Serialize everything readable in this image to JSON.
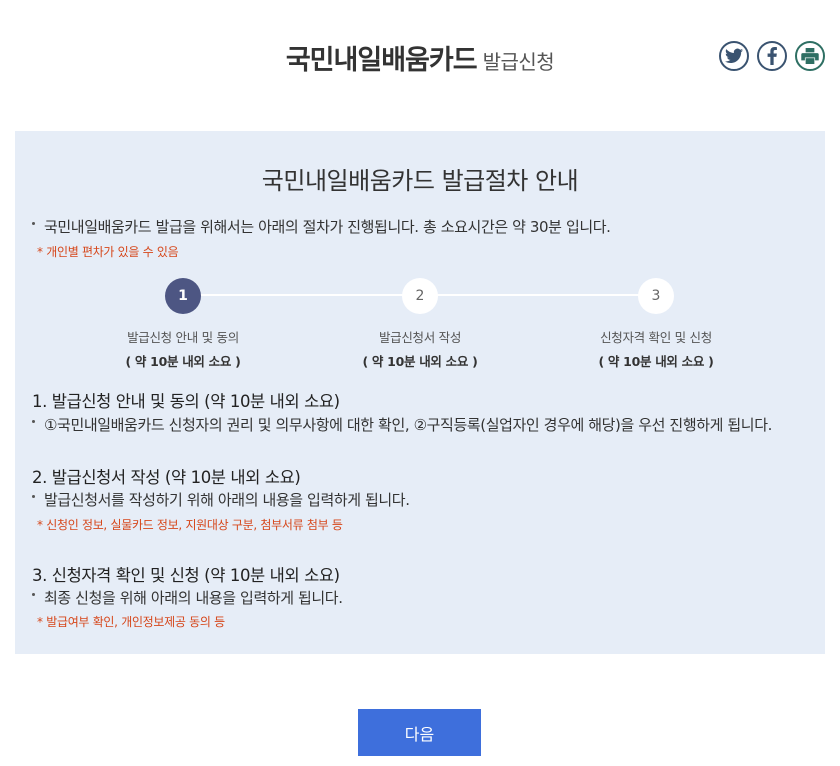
{
  "header": {
    "title_main": "국민내일배움카드",
    "title_sub": "발급신청",
    "share_icons": [
      "twitter-icon",
      "facebook-icon",
      "print-icon"
    ],
    "accent_color": "#3e6fdc"
  },
  "panel": {
    "title": "국민내일배움카드 발급절차 안내",
    "intro": "국민내일배움카드 발급을 위해서는 아래의 절차가 진행됩니다. 총 소요시간은 약 30분 입니다.",
    "intro_note": "* 개인별 편차가 있을 수 있음",
    "steps": [
      {
        "number": "1",
        "label": "발급신청 안내 및 동의",
        "time": "( 약 10분 내외 소요 )",
        "active": true
      },
      {
        "number": "2",
        "label": "발급신청서 작성",
        "time": "( 약 10분 내외 소요 )",
        "active": false
      },
      {
        "number": "3",
        "label": "신청자격 확인 및 신청",
        "time": "( 약 10분 내외 소요 )",
        "active": false
      }
    ],
    "sections": [
      {
        "title": "1. 발급신청 안내 및 동의 (약 10분 내외 소요)",
        "desc": "①국민내일배움카드 신청자의 권리 및 의무사항에 대한 확인, ②구직등록(실업자인 경우에 해당)을 우선 진행하게 됩니다.",
        "note": ""
      },
      {
        "title": "2. 발급신청서 작성 (약 10분 내외 소요)",
        "desc": "발급신청서를 작성하기 위해 아래의 내용을 입력하게 됩니다.",
        "note": "* 신청인 정보, 실물카드 정보, 지원대상 구분, 첨부서류 첨부 등"
      },
      {
        "title": "3. 신청자격 확인 및 신청 (약 10분 내외 소요)",
        "desc": "최종 신청을 위해 아래의 내용을 입력하게 됩니다.",
        "note": "* 발급여부 확인, 개인정보제공 동의 등"
      }
    ]
  },
  "actions": {
    "next_label": "다음"
  }
}
